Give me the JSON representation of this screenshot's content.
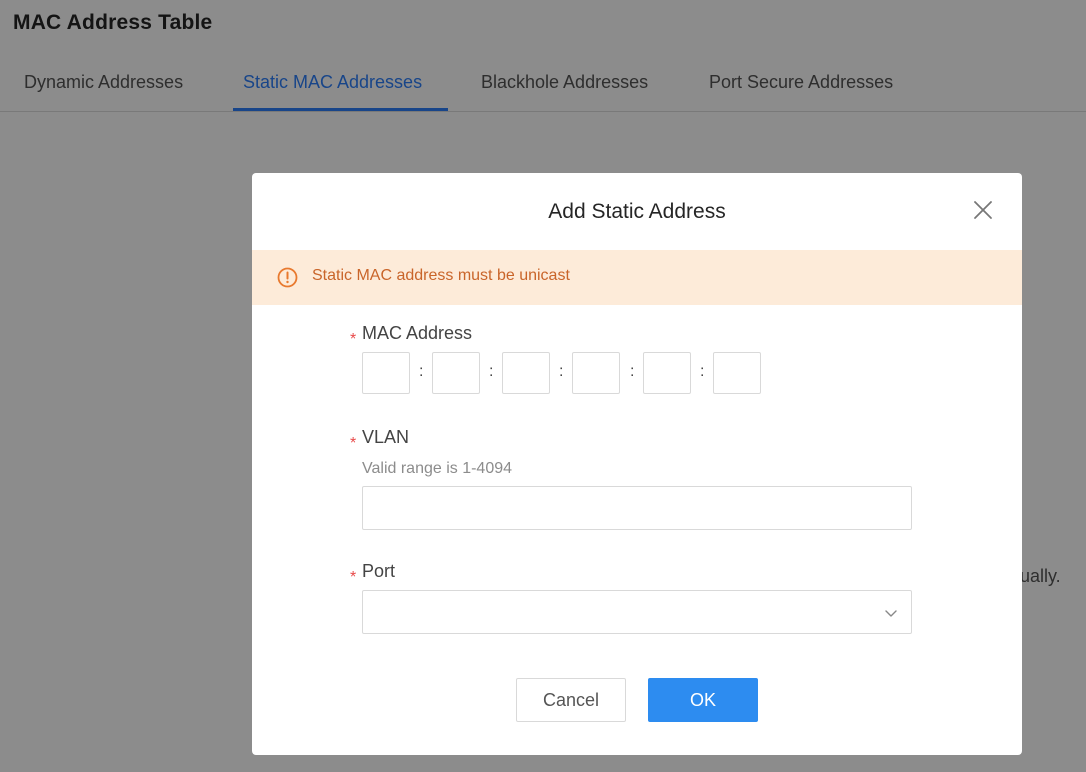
{
  "page": {
    "title": "MAC Address Table"
  },
  "tabs": [
    {
      "label": "Dynamic Addresses"
    },
    {
      "label": "Static MAC Addresses"
    },
    {
      "label": "Blackhole Addresses"
    },
    {
      "label": "Port Secure Addresses"
    }
  ],
  "active_tab": "Static MAC Addresses",
  "background_hint": "ually.",
  "modal": {
    "title": "Add Static Address",
    "warning": "Static MAC address must be unicast",
    "mac_label": "MAC Address",
    "mac_separator": ":",
    "mac_octets": [
      "",
      "",
      "",
      "",
      "",
      ""
    ],
    "vlan_label": "VLAN",
    "vlan_hint": "Valid range is 1-4094",
    "vlan_value": "",
    "port_label": "Port",
    "port_value": "",
    "required_mark": "*",
    "cancel_label": "Cancel",
    "ok_label": "OK"
  },
  "colors": {
    "accent": "#2d7ff9",
    "ok_button": "#2d8cf0",
    "warning_bg": "#fdebd9",
    "warning_text": "#c9652a",
    "required": "#e84a4a"
  },
  "icons": {
    "close": "close-icon",
    "warning": "exclamation-circle-icon",
    "dropdown": "chevron-down-icon"
  }
}
